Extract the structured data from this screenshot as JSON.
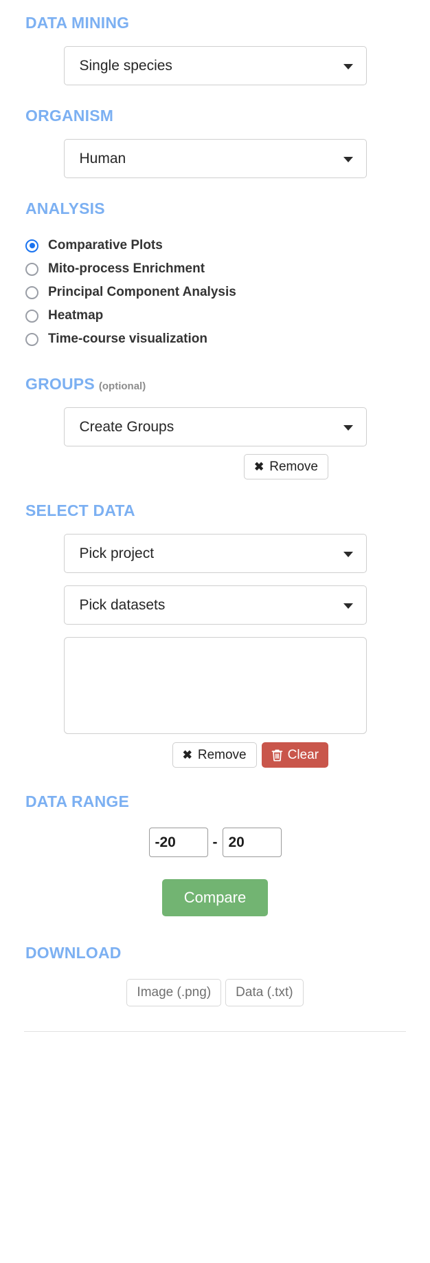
{
  "sections": {
    "data_mining": {
      "heading": "DATA MINING",
      "dropdown": {
        "value": "Single species",
        "caret_icon": "chevron-down-icon"
      }
    },
    "organism": {
      "heading": "ORGANISM",
      "dropdown": {
        "value": "Human",
        "caret_icon": "chevron-down-icon"
      }
    },
    "analysis": {
      "heading": "ANALYSIS",
      "options": [
        {
          "label": "Comparative Plots",
          "selected": true
        },
        {
          "label": "Mito-process Enrichment",
          "selected": false
        },
        {
          "label": "Principal Component Analysis",
          "selected": false
        },
        {
          "label": "Heatmap",
          "selected": false
        },
        {
          "label": "Time-course visualization",
          "selected": false
        }
      ]
    },
    "groups": {
      "heading": "GROUPS",
      "heading_note": "(optional)",
      "dropdown": {
        "value": "Create Groups",
        "caret_icon": "chevron-down-icon"
      },
      "remove_button": {
        "label": "Remove",
        "icon": "close-x-icon"
      }
    },
    "select_data": {
      "heading": "SELECT DATA",
      "project_dropdown": {
        "value": "Pick project",
        "caret_icon": "chevron-down-icon"
      },
      "datasets_dropdown": {
        "value": "Pick datasets",
        "caret_icon": "chevron-down-icon"
      },
      "selected_list": {
        "items": []
      },
      "remove_button": {
        "label": "Remove",
        "icon": "close-x-icon"
      },
      "clear_button": {
        "label": "Clear",
        "icon": "trash-icon",
        "color": "#c9564b"
      }
    },
    "data_range": {
      "heading": "DATA RANGE",
      "min_value": "-20",
      "separator": "-",
      "max_value": "20",
      "compare_button": {
        "label": "Compare",
        "color": "#72b472"
      }
    },
    "download": {
      "heading": "DOWNLOAD",
      "buttons": [
        {
          "label": "Image (.png)"
        },
        {
          "label": "Data (.txt)"
        }
      ]
    }
  },
  "colors": {
    "heading_blue": "#7cb0f2",
    "radio_selected_blue": "#1a73f0",
    "danger_red": "#c9564b",
    "success_green": "#72b472",
    "border_gray": "#cfcfcf"
  }
}
